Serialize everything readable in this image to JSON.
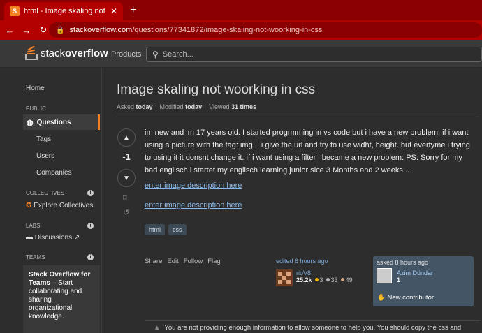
{
  "browser": {
    "tab_title": "html - Image skaling not woorkin",
    "url_host": "stackoverflow.com",
    "url_path": "/questions/77341872/image-skaling-not-woorking-in-css"
  },
  "header": {
    "logo_plain": "stack",
    "logo_bold": "overflow",
    "products": "Products",
    "search_placeholder": "Search..."
  },
  "sidebar": {
    "home": "Home",
    "public": "PUBLIC",
    "questions": "Questions",
    "tags": "Tags",
    "users": "Users",
    "companies": "Companies",
    "collectives": "COLLECTIVES",
    "explore": "Explore Collectives",
    "labs": "LABS",
    "discussions": "Discussions",
    "teams": "TEAMS",
    "teams_title": "Stack Overflow for Teams",
    "teams_text": "– Start collaborating and sharing organizational knowledge."
  },
  "question": {
    "title": "Image skaling not woorking in css",
    "asked_label": "Asked",
    "asked_value": "today",
    "modified_label": "Modified",
    "modified_value": "today",
    "viewed_label": "Viewed",
    "viewed_value": "31 times",
    "score": "-1",
    "body": "im new and im 17 years old. I started progrmming in vs code but i have a new problem. if i want using a picture with the tag: img... i give the url and try to use widht, height. but evertyme i trying to using it it donsnt change it. if i want using a filter i became a new problem: PS: Sorry for my bad englisch i startet my englisch learning junior sice 3 Months and 2 weeks...",
    "link1": "enter image description here",
    "link2": "enter image description here",
    "tags": [
      "html",
      "css"
    ],
    "actions": [
      "Share",
      "Edit",
      "Follow",
      "Flag"
    ]
  },
  "editor": {
    "label": "edited 6 hours ago",
    "name": "rioV8",
    "rep": "25.2k",
    "gold": "3",
    "silver": "33",
    "bronze": "49"
  },
  "asker": {
    "label": "asked 8 hours ago",
    "name": "Azim Dündar",
    "rep": "1",
    "badge": "New contributor"
  },
  "comment": {
    "text": "You are not providing enough information to allow someone to help you. You should copy the css and"
  },
  "colors": {
    "accent": "#f48024",
    "browser_red": "#b30000",
    "link": "#8bb8e8"
  }
}
